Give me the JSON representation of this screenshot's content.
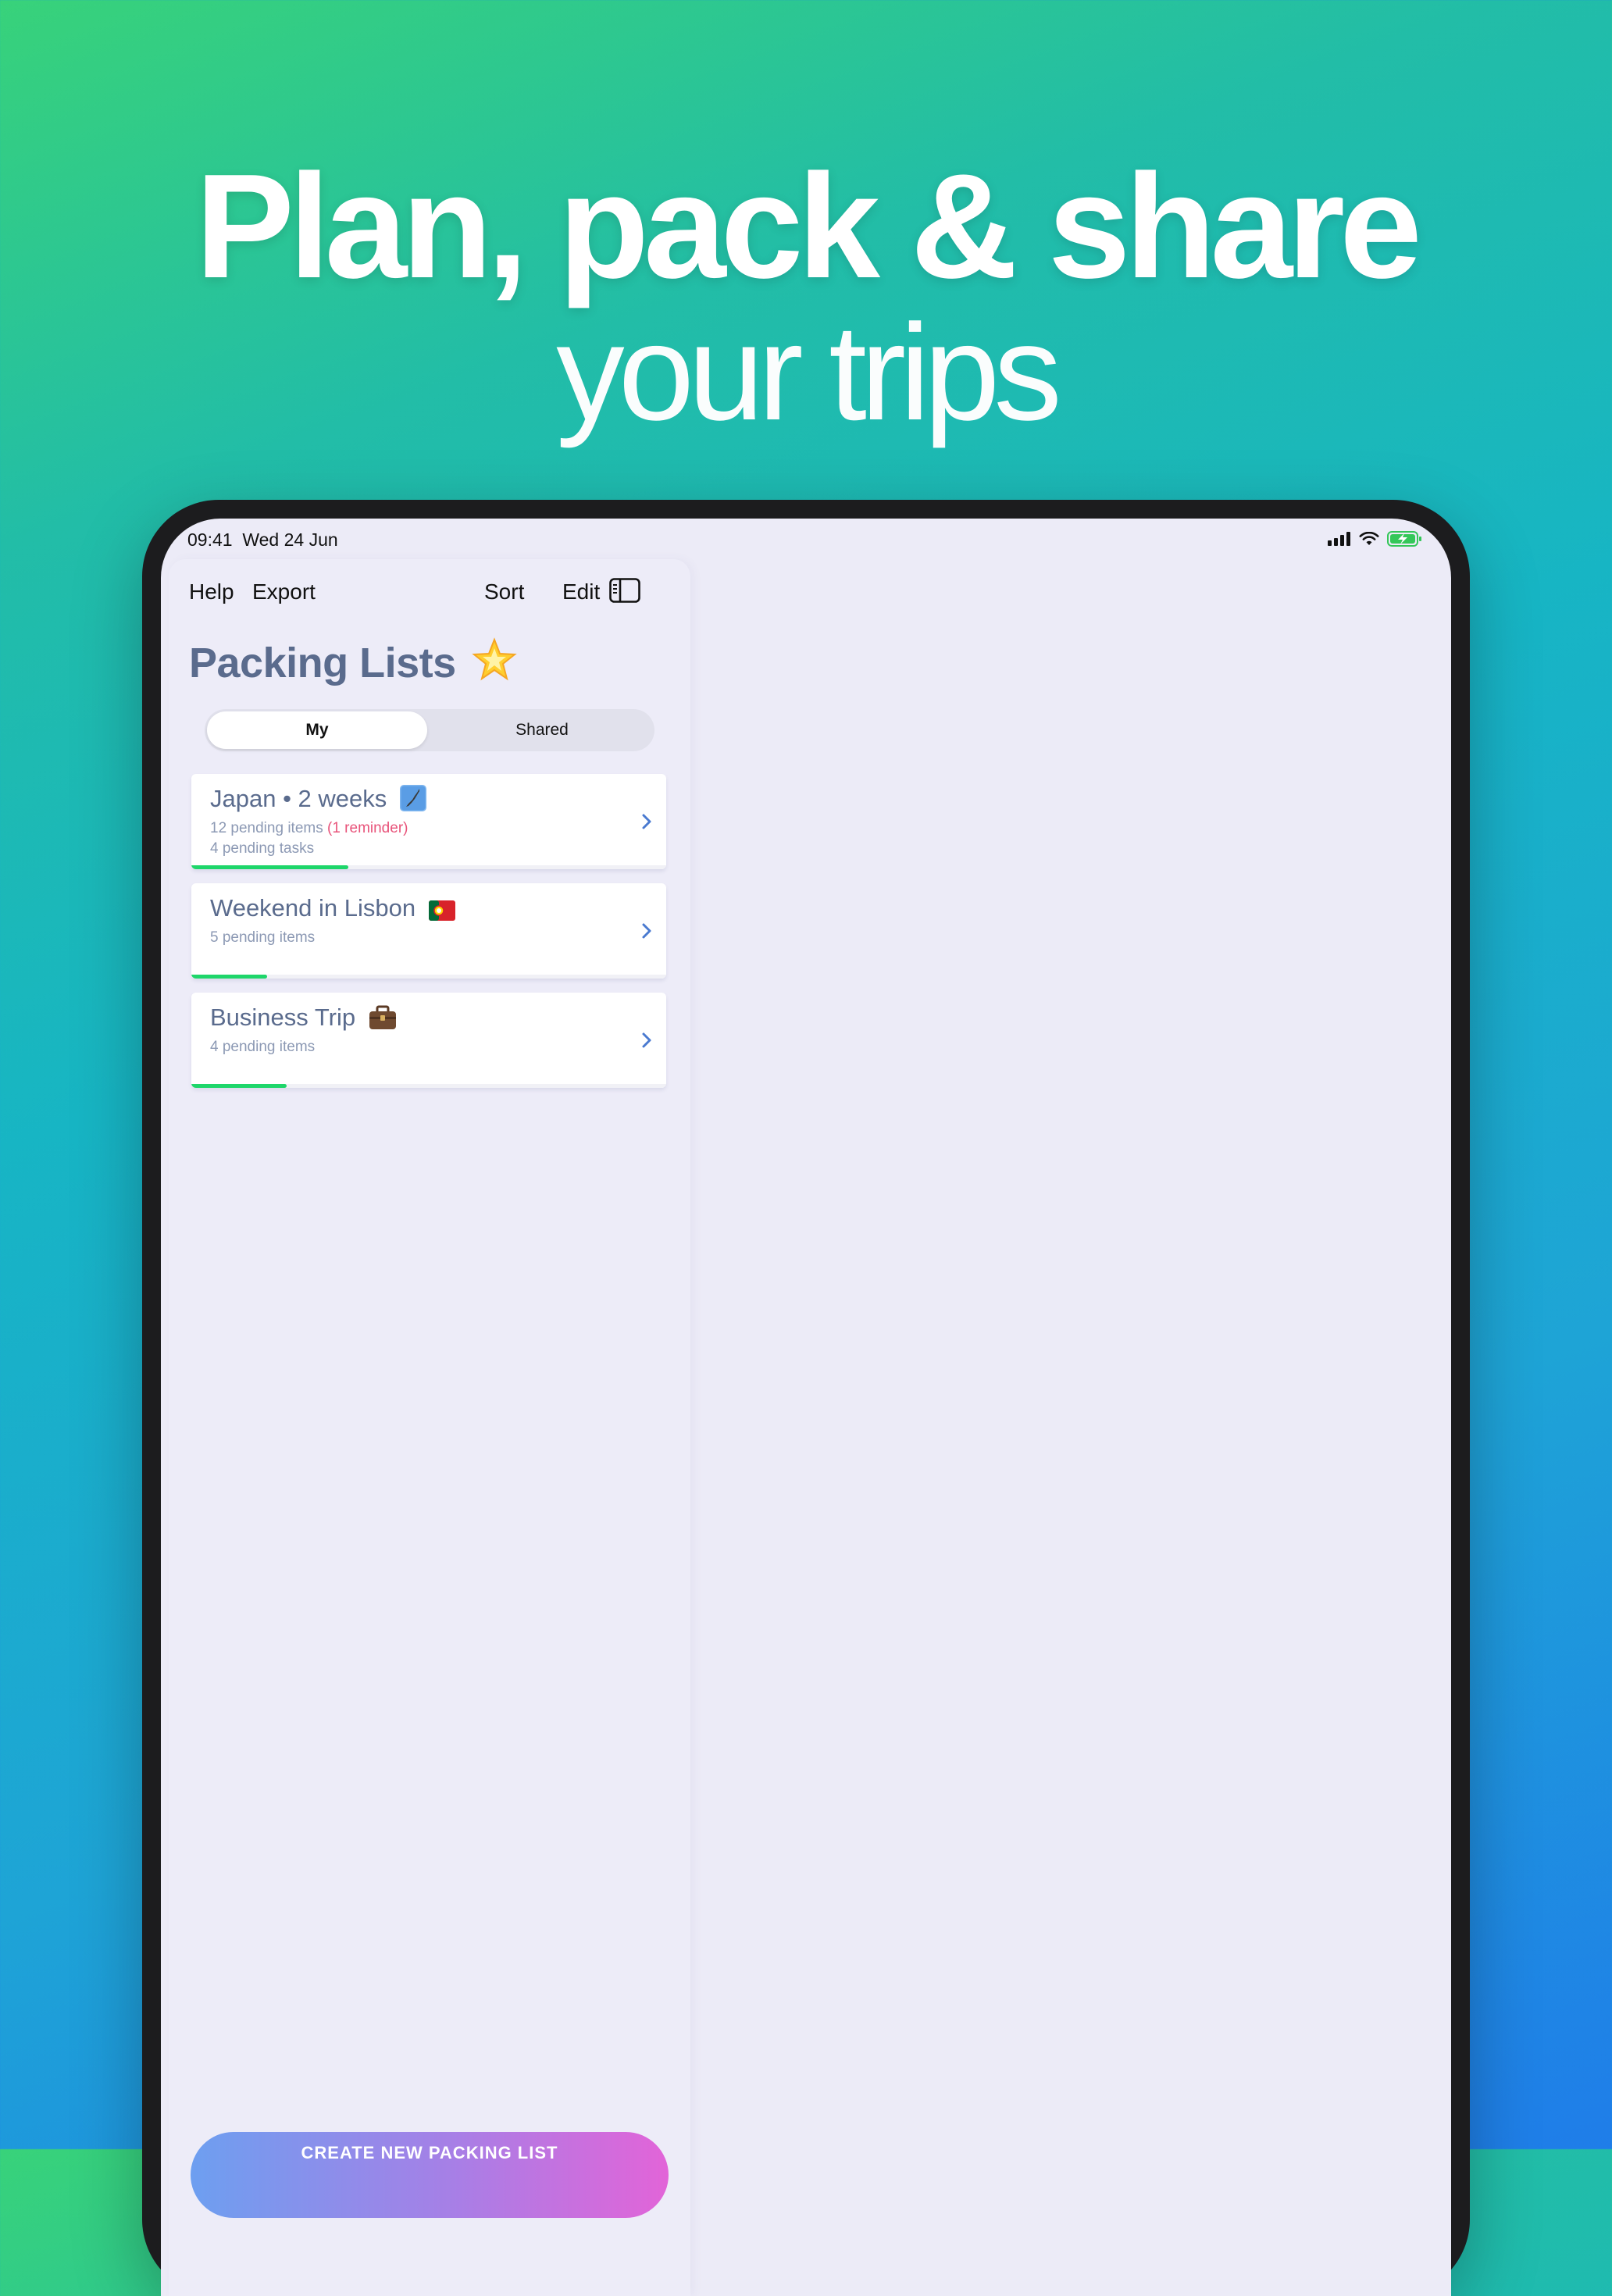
{
  "headline": {
    "line1": "Plan, pack & share",
    "line2": "your trips"
  },
  "status_bar": {
    "time": "09:41",
    "date": "Wed 24 Jun"
  },
  "nav": {
    "help": "Help",
    "export": "Export",
    "sort": "Sort",
    "edit": "Edit"
  },
  "page": {
    "title": "Packing Lists"
  },
  "tabs": {
    "my": "My",
    "shared": "Shared",
    "selected": "My"
  },
  "lists": [
    {
      "title": "Japan • 2 weeks",
      "icon": "japan-map-icon",
      "pending_items": "12 pending items",
      "reminder": "(1 reminder)",
      "pending_tasks": "4 pending tasks",
      "progress": 0.33
    },
    {
      "title": "Weekend in Lisbon",
      "icon": "portugal-flag-icon",
      "pending_items": "5 pending items",
      "progress": 0.16
    },
    {
      "title": "Business Trip",
      "icon": "briefcase-icon",
      "pending_items": "4 pending items",
      "progress": 0.2
    }
  ],
  "actions": {
    "create": "CREATE NEW PACKING LIST"
  },
  "colors": {
    "title": "#5a6b8d",
    "progress": "#1ed66a",
    "reminder": "#e8537a",
    "chevron": "#4a7ad0"
  }
}
